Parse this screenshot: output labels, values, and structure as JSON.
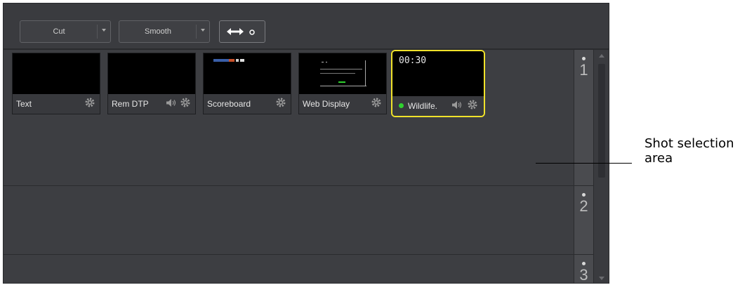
{
  "toolbar": {
    "transition_label": "Cut",
    "curve_label": "Smooth"
  },
  "shots": [
    {
      "name": "Text"
    },
    {
      "name": "Rem DTP"
    },
    {
      "name": "Scoreboard"
    },
    {
      "name": "Web Display"
    },
    {
      "name": "Wildlife.",
      "timecode": "00:30",
      "status_color": "#2fd12f"
    }
  ],
  "rows": [
    {
      "number": "1"
    },
    {
      "number": "2"
    },
    {
      "number": "3"
    }
  ],
  "callout": {
    "line1": "Shot selection",
    "line2": "area"
  },
  "colors": {
    "selected_border": "#f0e22a",
    "live": "#2fd12f"
  }
}
